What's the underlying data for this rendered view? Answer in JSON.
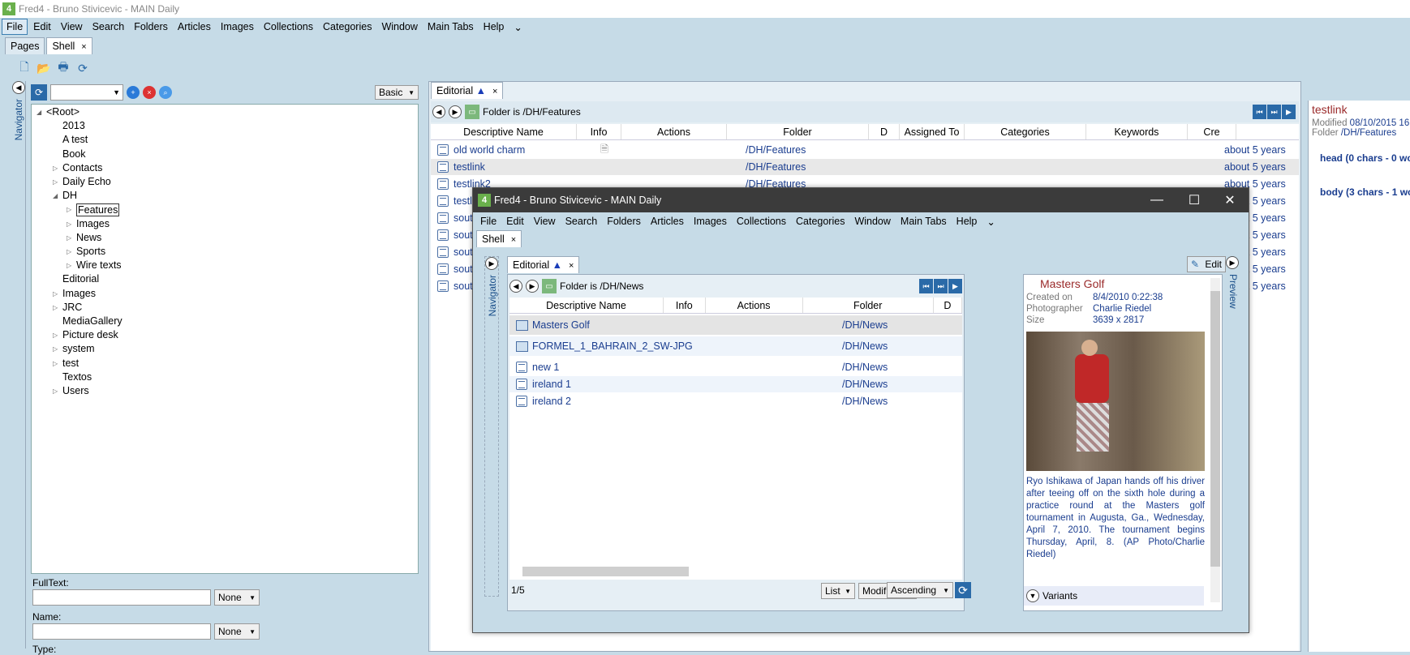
{
  "window": {
    "title": "Fred4 - Bruno Stivicevic - MAIN Daily",
    "logo": "4"
  },
  "menu": [
    "File",
    "Edit",
    "View",
    "Search",
    "Folders",
    "Articles",
    "Images",
    "Collections",
    "Categories",
    "Window",
    "Main Tabs",
    "Help"
  ],
  "top_tabs": [
    {
      "label": "Pages"
    },
    {
      "label": "Shell",
      "close": "×"
    }
  ],
  "navigator": {
    "label": "Navigator",
    "mode": "Basic"
  },
  "tree": [
    "<Root>",
    "2013",
    "A test",
    "Book",
    "Contacts",
    "Daily Echo",
    "DH",
    "Features",
    "Images",
    "News",
    "Sports",
    "Wire texts",
    "Editorial",
    "Images",
    "JRC",
    "MediaGallery",
    "Picture desk",
    "system",
    "test",
    "Textos",
    "Users"
  ],
  "search": {
    "fulltext_label": "FullText:",
    "fulltext_option": "None",
    "name_label": "Name:",
    "name_option": "None",
    "type_label": "Type:"
  },
  "editorial": {
    "tab": "Editorial",
    "close": "×",
    "folder": "Folder is /DH/Features",
    "columns": [
      "Descriptive Name",
      "Info",
      "Actions",
      "Folder",
      "D",
      "Assigned To",
      "Categories",
      "Keywords",
      "Cre"
    ],
    "rows": [
      {
        "name": "old world charm",
        "folder": "/DH/Features",
        "created": "about 5 years"
      },
      {
        "name": "testlink",
        "folder": "/DH/Features",
        "created": "about 5 years"
      },
      {
        "name": "testlink2",
        "folder": "/DH/Features",
        "created": "about 5 years"
      },
      {
        "name": "testl",
        "folder": "",
        "created": "about 5 years"
      },
      {
        "name": "sout",
        "folder": "",
        "created": "about 5 years"
      },
      {
        "name": "sout",
        "folder": "",
        "created": "about 5 years"
      },
      {
        "name": "sout",
        "folder": "",
        "created": "about 5 years"
      },
      {
        "name": "sout",
        "folder": "",
        "created": "about 5 years"
      },
      {
        "name": "sout",
        "folder": "",
        "created": "about 5 years"
      }
    ]
  },
  "right_preview": {
    "title": "testlink",
    "modified_label": "Modified",
    "modified": "08/10/2015 16",
    "folder_label": "Folder",
    "folder": "/DH/Features",
    "items": [
      "head (0 chars - 0 wo",
      "body (3 chars - 1 wo"
    ]
  },
  "float": {
    "title": "Fred4 - Bruno Stivicevic - MAIN Daily",
    "shell_tab": "Shell",
    "close": "×",
    "nav_label": "Navigator",
    "preview_label": "Preview",
    "editorial_tab": "Editorial",
    "folder": "Folder is /DH/News",
    "edit": "Edit",
    "columns": [
      "Descriptive Name",
      "Info",
      "Actions",
      "Folder",
      "D"
    ],
    "rows": [
      {
        "name": "Masters Golf",
        "folder": "/DH/News",
        "type": "image"
      },
      {
        "name": "FORMEL_1_BAHRAIN_2_SW-JPG",
        "folder": "/DH/News",
        "type": "image"
      },
      {
        "name": "new 1",
        "folder": "/DH/News",
        "type": "doc"
      },
      {
        "name": "ireland 1",
        "folder": "/DH/News",
        "type": "doc"
      },
      {
        "name": "ireland 2",
        "folder": "/DH/News",
        "type": "doc"
      }
    ],
    "count": "1/5",
    "view": "List",
    "sort": "Modified",
    "order": "Ascending",
    "detail": {
      "title": "Masters Golf",
      "created_label": "Created on",
      "created": "8/4/2010 0:22:38",
      "photographer_label": "Photographer",
      "photographer": "Charlie Riedel",
      "size_label": "Size",
      "size": "3639 x 2817",
      "caption": "Ryo Ishikawa of Japan hands off his driver after teeing off on the sixth hole during a practice round at the Masters golf tournament in Augusta, Ga., Wednesday, April 7, 2010. The tournament begins Thursday, April, 8. (AP Photo/Charlie Riedel)",
      "variants": "Variants"
    }
  }
}
